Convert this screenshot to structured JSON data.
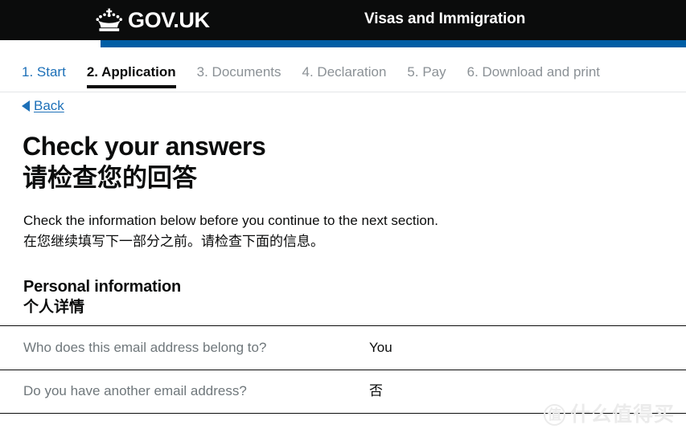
{
  "header": {
    "crown_icon": "gov-uk-crown-icon",
    "brand_name": "GOV.UK",
    "service_name": "Visas and Immigration",
    "accent_blue": "#005ea5",
    "background": "#0b0c0c"
  },
  "progress_nav": {
    "items": [
      {
        "label": "1. Start",
        "state": "done"
      },
      {
        "label": "2. Application",
        "state": "current"
      },
      {
        "label": "3. Documents",
        "state": "pending"
      },
      {
        "label": "4. Declaration",
        "state": "pending"
      },
      {
        "label": "5. Pay",
        "state": "pending"
      },
      {
        "label": "6. Download and print",
        "state": "pending"
      }
    ]
  },
  "back": {
    "label": "Back",
    "arrow_icon": "back-arrow-icon",
    "color": "#1d70b8"
  },
  "main": {
    "heading_en": "Check your answers",
    "heading_cn": "请检查您的回答",
    "lede_en": "Check the information below before you continue to the next section.",
    "lede_cn": "在您继续填写下一部分之前。请检查下面的信息。",
    "section_heading_en": "Personal information",
    "section_heading_cn": "个人详情",
    "summary_rows": [
      {
        "key": "Who does this email address belong to?",
        "value": "You"
      },
      {
        "key": "Do you have another email address?",
        "value": "否"
      }
    ]
  },
  "watermark": {
    "badge": "值",
    "text": "什么值得买",
    "color": "#ebebeb"
  }
}
